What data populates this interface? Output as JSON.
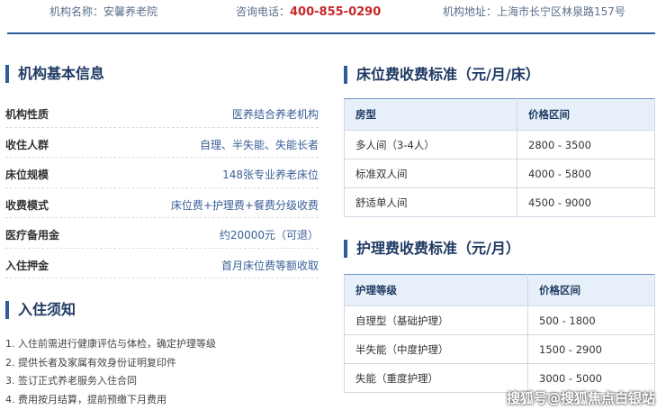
{
  "header": {
    "name_label": "机构名称：",
    "name_value": "安馨养老院",
    "phone_label": "咨询电话：",
    "phone_value": "400-855-0290",
    "address_label": "机构地址：",
    "address_value": "上海市长宁区林泉路157号"
  },
  "basic_info": {
    "title": "机构基本信息",
    "rows": [
      {
        "label": "机构性质",
        "value": "医养结合养老机构"
      },
      {
        "label": "收住人群",
        "value": "自理、半失能、失能长者"
      },
      {
        "label": "床位规模",
        "value": "148张专业养老床位"
      },
      {
        "label": "收费模式",
        "value": "床位费+护理费+餐费分级收费"
      },
      {
        "label": "医疗备用金",
        "value": "约20000元（可退）"
      },
      {
        "label": "入住押金",
        "value": "首月床位费等额收取"
      }
    ]
  },
  "admission": {
    "title": "入住须知",
    "items": [
      "1. 入住前需进行健康评估与体检，确定护理等级",
      "2. 提供长者及家属有效身份证明复印件",
      "3. 签订正式养老服务入住合同",
      "4. 费用按月结算，提前预缴下月费用"
    ]
  },
  "bed_fee": {
    "title": "床位费收费标准（元/月/床）",
    "headers": [
      "房型",
      "价格区间"
    ],
    "rows": [
      [
        "多人间（3-4人）",
        "2800 - 3500"
      ],
      [
        "标准双人间",
        "4000 - 5800"
      ],
      [
        "舒适单人间",
        "4500 - 9000"
      ]
    ]
  },
  "care_fee": {
    "title": "护理费收费标准（元/月）",
    "headers": [
      "护理等级",
      "价格区间"
    ],
    "rows": [
      [
        "自理型（基础护理）",
        "500 - 1800"
      ],
      [
        "半失能（中度护理）",
        "1500 - 2900"
      ],
      [
        "失能（重度护理）",
        "3000 - 5000"
      ]
    ]
  },
  "watermark": "搜狐号@搜狐焦点白银站",
  "colors": {
    "accent": "#2f5d9a",
    "phone": "#c62828",
    "header_bg": "#e7f0fa"
  }
}
